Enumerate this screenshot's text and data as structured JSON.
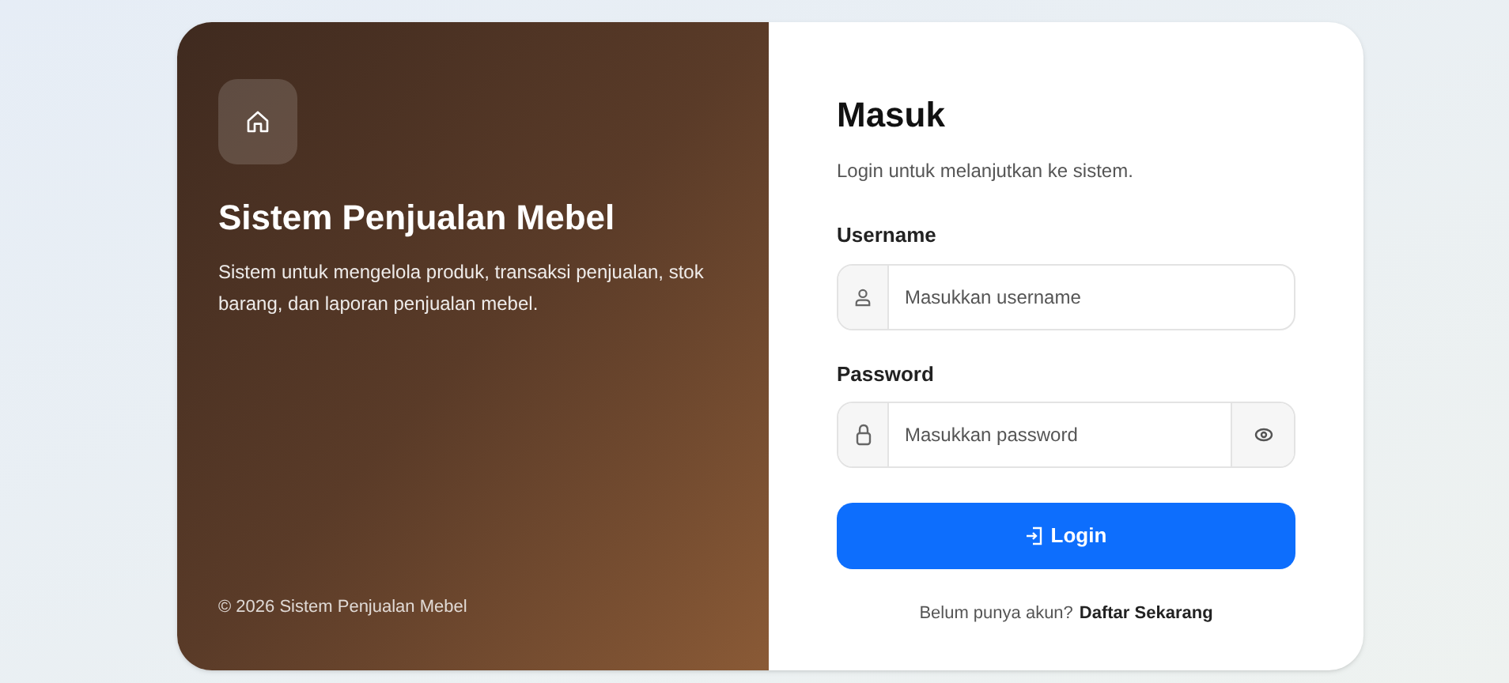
{
  "brand": {
    "title": "Sistem Penjualan Mebel",
    "description": "Sistem untuk mengelola produk, transaksi penjualan, stok barang, dan laporan penjualan mebel.",
    "footer": "© 2026 Sistem Penjualan Mebel"
  },
  "form": {
    "title": "Masuk",
    "subtitle": "Login untuk melanjutkan ke sistem.",
    "fields": [
      {
        "label": "Username",
        "placeholder": "Masukkan username",
        "kind": "text"
      },
      {
        "label": "Password",
        "placeholder": "Masukkan password",
        "kind": "password"
      }
    ],
    "submit": "Login",
    "signup_prompt": "Belum punya akun?",
    "signup_link": "Daftar Sekarang"
  }
}
